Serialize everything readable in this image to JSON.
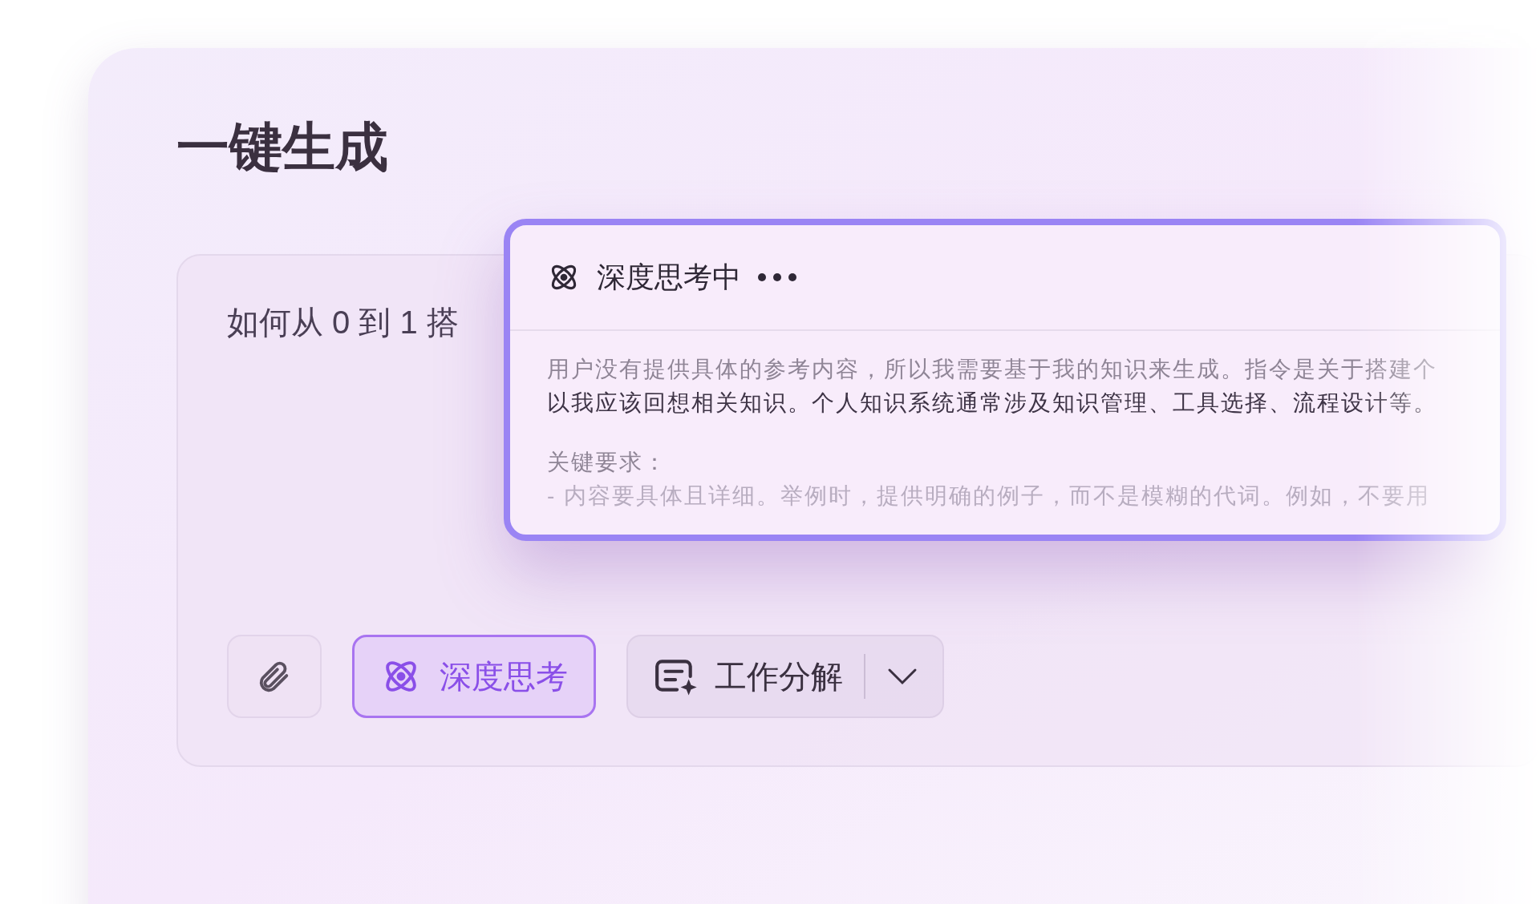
{
  "title": "一键生成",
  "input": {
    "value": "如何从 0 到 1 搭"
  },
  "thinking_panel": {
    "status": "深度思考中",
    "paragraphs": [
      [
        {
          "text": "用户没有提供具体的参考内容，所以我需要基于我的知识来生成。指令是关于搭建个",
          "kind": "muted"
        },
        {
          "text": "以我应该回想相关知识。个人知识系统通常涉及知识管理、工具选择、流程设计等。",
          "kind": "strong"
        }
      ],
      [
        {
          "text": "关键要求：",
          "kind": "muted"
        },
        {
          "text": "- 内容要具体且详细。举例时，提供明确的例子，而不是模糊的代词。例如，不要用",
          "kind": "faint"
        }
      ]
    ]
  },
  "toolbar": {
    "deep_think": {
      "label": "深度思考",
      "selected": true
    },
    "mode": {
      "label": "工作分解"
    }
  }
}
